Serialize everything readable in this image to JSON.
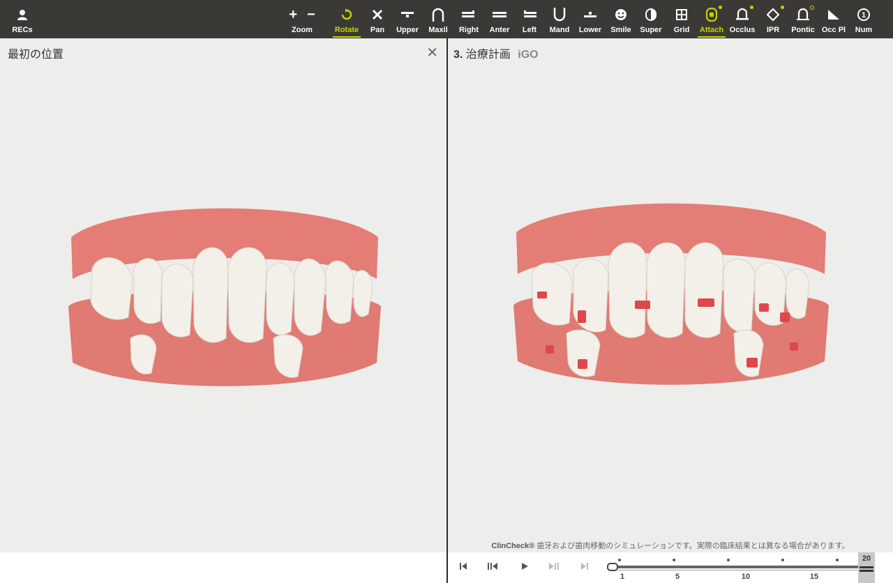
{
  "toolbar": {
    "recs_label": "RECs",
    "zoom_label": "Zoom",
    "tools": [
      {
        "label": "Rotate",
        "icon": "rotate-icon",
        "active": true
      },
      {
        "label": "Pan",
        "icon": "pan-icon"
      },
      {
        "label": "Upper",
        "icon": "upper-icon"
      },
      {
        "label": "Maxil",
        "icon": "maxil-icon"
      },
      {
        "label": "Right",
        "icon": "right-icon"
      },
      {
        "label": "Anter",
        "icon": "anter-icon"
      },
      {
        "label": "Left",
        "icon": "left-icon"
      },
      {
        "label": "Mand",
        "icon": "mand-icon"
      },
      {
        "label": "Lower",
        "icon": "lower-icon"
      },
      {
        "label": "Smile",
        "icon": "smile-icon"
      },
      {
        "label": "Super",
        "icon": "super-icon"
      },
      {
        "label": "Grid",
        "icon": "grid-icon"
      },
      {
        "label": "Attach",
        "icon": "attach-icon",
        "active": true
      },
      {
        "label": "Occlus",
        "icon": "occlus-icon"
      },
      {
        "label": "IPR",
        "icon": "ipr-icon"
      },
      {
        "label": "Pontic",
        "icon": "pontic-icon"
      },
      {
        "label": "Occ Pl",
        "icon": "occ-pl-icon"
      },
      {
        "label": "Num",
        "icon": "num-icon"
      }
    ]
  },
  "left_pane": {
    "title": "最初の位置",
    "close_symbol": "✕"
  },
  "right_pane": {
    "step": "3.",
    "title": "治療計画",
    "badge": "iGO",
    "disclaimer_brand": "ClinCheck®",
    "disclaimer_text": " 歯牙および歯肉移動のシミュレーションです。実際の臨床結果とは異なる場合があります。"
  },
  "timeline": {
    "tick_labels": [
      "1",
      "5",
      "10",
      "15"
    ],
    "total": "20"
  },
  "colors": {
    "accent": "#c7d400",
    "toolbar_bg": "#3b3936",
    "gum": "#e07a72",
    "tooth": "#f2efe8",
    "attachment": "#e0474a"
  }
}
